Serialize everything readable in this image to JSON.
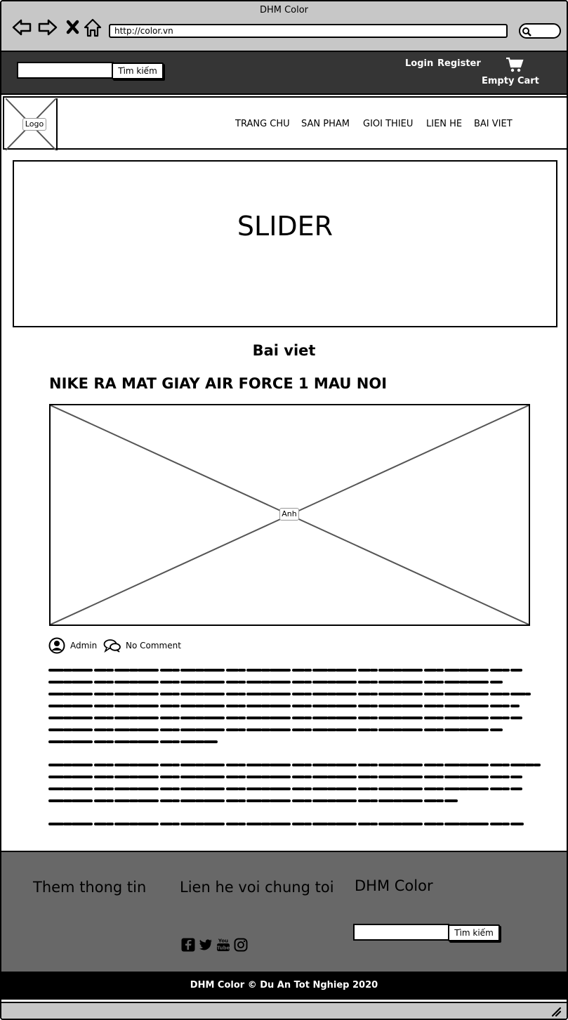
{
  "window": {
    "title": "DHM Color",
    "url": "http://color.vn"
  },
  "topbar": {
    "search_button": "Tìm kiếm",
    "login": "Login",
    "register": "Register",
    "cart_label": "Empty Cart"
  },
  "header": {
    "logo_label": "Logo",
    "menu": [
      "TRANG CHU",
      "SAN PHAM",
      "GIOI THIEU",
      "LIEN HE",
      "BAI VIET"
    ]
  },
  "slider": {
    "label": "SLIDER"
  },
  "main": {
    "section_title": "Bai viet",
    "post_title": "NIKE RA MAT GIAY AIR FORCE 1 MAU NOI",
    "image_label": "Anh",
    "author": "Admin",
    "comments": "No Comment"
  },
  "footer": {
    "col1_title": "Them thong tin",
    "col2_title": "Lien he voi chung toi",
    "col3_title": "DHM Color",
    "search_button": "Tìm kiếm",
    "social_icons": [
      "facebook-icon",
      "twitter-icon",
      "youtube-icon",
      "instagram-icon"
    ],
    "copyright": "DHM Color © Du An Tot Nghiep 2020"
  },
  "colors": {
    "chrome": "#c7c7c7",
    "topbar": "#353535",
    "footer": "#686868",
    "copyright_bar": "#000000"
  }
}
